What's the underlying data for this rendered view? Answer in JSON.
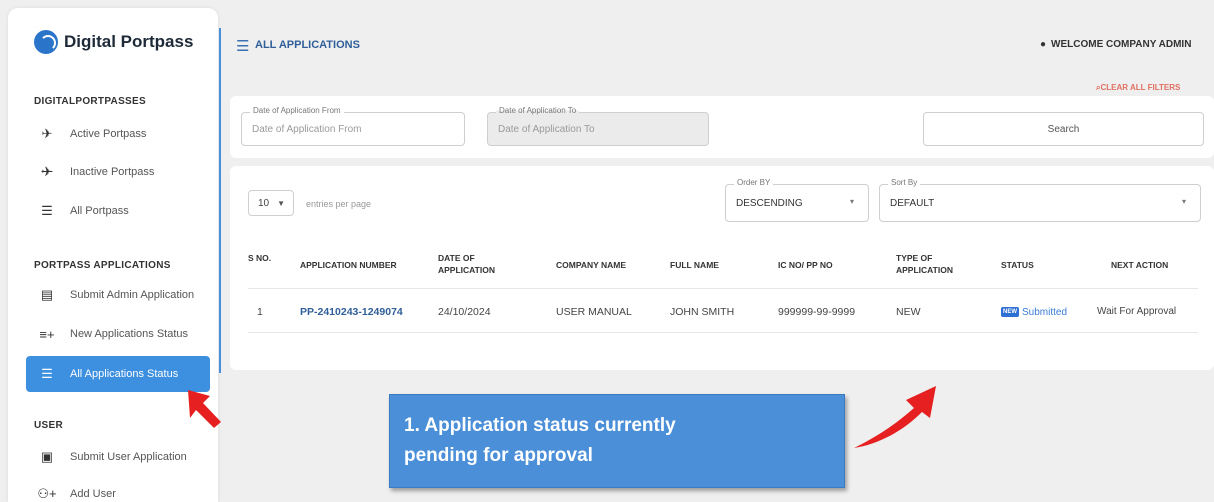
{
  "sidebar": {
    "brand": "Digital Portpass",
    "sections": [
      {
        "title": "DIGITALPORTPASSES"
      },
      {
        "title": "PORTPASS APPLICATIONS"
      },
      {
        "title": "USER"
      }
    ],
    "items": [
      {
        "label": "Active Portpass",
        "icon": "airplane-icon"
      },
      {
        "label": "Inactive Portpass",
        "icon": "airplane-off-icon"
      },
      {
        "label": "All Portpass",
        "icon": "list-icon"
      },
      {
        "label": "Submit Admin Application",
        "icon": "document-edit-icon"
      },
      {
        "label": "New Applications Status",
        "icon": "list-add-icon"
      },
      {
        "label": "All Applications Status",
        "icon": "list-icon",
        "active": true
      },
      {
        "label": "Submit User Application",
        "icon": "id-card-icon"
      },
      {
        "label": "Add User",
        "icon": "add-user-icon"
      }
    ]
  },
  "header": {
    "title": "ALL APPLICATIONS",
    "welcome": "WELCOME COMPANY ADMIN",
    "clear_filters": "CLEAR ALL FILTERS"
  },
  "filters": {
    "date_from": {
      "label": "Date of Application From",
      "placeholder": "Date of Application From"
    },
    "date_to": {
      "label": "Date of Application To",
      "placeholder": "Date of Application To"
    },
    "search": {
      "placeholder": "Search"
    }
  },
  "table": {
    "entries_value": "10",
    "entries_label": "entries per page",
    "order_by": {
      "label": "Order BY",
      "value": "DESCENDING"
    },
    "sort_by": {
      "label": "Sort By",
      "value": "DEFAULT"
    },
    "headers": [
      "S NO.",
      "APPLICATION NUMBER",
      "DATE OF APPLICATION",
      "COMPANY NAME",
      "FULL NAME",
      "IC NO/ PP NO",
      "TYPE OF APPLICATION",
      "STATUS",
      "NEXT ACTION"
    ],
    "rows": [
      {
        "sno": "1",
        "application_number": "PP-2410243-1249074",
        "date": "24/10/2024",
        "company": "USER MANUAL",
        "full_name": "JOHN SMITH",
        "ic_no": "999999-99-9999",
        "type": "NEW",
        "status_badge": "NEW",
        "status": "Submitted",
        "next_action": "Wait For Approval"
      }
    ]
  },
  "callout": {
    "line1": "1. Application status currently",
    "line2": "pending for approval"
  },
  "colors": {
    "accent": "#3d8fe0",
    "link": "#2f5e98",
    "clear": "#e07060",
    "arrow": "#e62020",
    "callout": "#4a8fd8"
  }
}
